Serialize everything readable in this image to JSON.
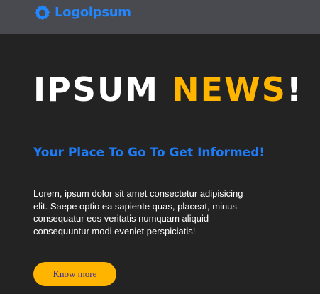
{
  "navbar": {
    "logo_icon": "logo-ring-icon",
    "logo_text": "Logoipsum",
    "logo_color": "#2287ff"
  },
  "hero": {
    "word1": "IPSUM ",
    "word2": "NEWS",
    "word3": "!",
    "highlight_color": "#ffb400"
  },
  "tagline": "Your Place To Go To Get Informed!",
  "body_text": "Lorem, ipsum dolor sit amet consectetur adipisicing elit. Saepe optio ea sapiente quas, placeat, minus consequatur eos veritatis numquam aliquid consequuntur modi eveniet perspiciatis!",
  "cta_label": "Know more",
  "colors": {
    "background": "#232323",
    "navbar": "#484a50",
    "accent_blue": "#1f7cf6",
    "accent_yellow": "#ffb400"
  }
}
